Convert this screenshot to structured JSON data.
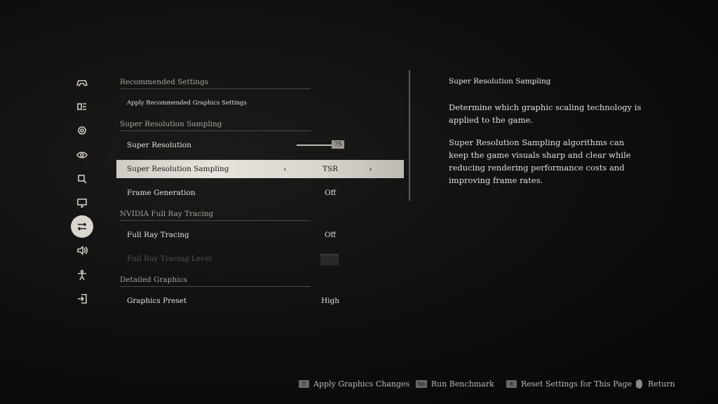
{
  "nav": [
    {
      "id": "gamepad",
      "icon": "gamepad-icon",
      "active": false
    },
    {
      "id": "display",
      "icon": "display-mode-icon",
      "active": false
    },
    {
      "id": "camera",
      "icon": "camera-icon",
      "active": false
    },
    {
      "id": "visibility",
      "icon": "eye-icon",
      "active": false
    },
    {
      "id": "search",
      "icon": "magnifier-icon",
      "active": false
    },
    {
      "id": "monitor",
      "icon": "monitor-icon",
      "active": false
    },
    {
      "id": "graphics",
      "icon": "sliders-icon",
      "active": true
    },
    {
      "id": "audio",
      "icon": "speaker-icon",
      "active": false
    },
    {
      "id": "accessibility",
      "icon": "accessibility-icon",
      "active": false
    },
    {
      "id": "exit",
      "icon": "exit-icon",
      "active": false
    }
  ],
  "settings": {
    "section_recommended": "Recommended Settings",
    "apply_recommended": "Apply Recommended Graphics Settings",
    "section_srs": "Super Resolution Sampling",
    "super_resolution": {
      "label": "Super Resolution",
      "value": "75",
      "level": 0.75
    },
    "srs": {
      "label": "Super Resolution Sampling",
      "value": "TSR"
    },
    "frame_generation": {
      "label": "Frame Generation",
      "value": "Off"
    },
    "section_rt": "NVIDIA Full Ray Tracing",
    "full_ray_tracing": {
      "label": "Full Ray Tracing",
      "value": "Off"
    },
    "rt_level": {
      "label": "Full Ray Tracing Level"
    },
    "section_detailed": "Detailed Graphics",
    "graphics_preset": {
      "label": "Graphics Preset",
      "value": "High"
    }
  },
  "description": {
    "title": "Super Resolution Sampling",
    "p1": "Determine which graphic scaling technology is applied to the game.",
    "p2": "Super Resolution Sampling algorithms can keep the game visuals sharp and clear while reducing rendering performance costs and improving frame rates."
  },
  "footer": {
    "apply": {
      "key": "T",
      "label": "Apply Graphics Changes"
    },
    "benchmark": {
      "key": "Tab",
      "label": "Run Benchmark"
    },
    "reset": {
      "key": "R",
      "label": "Reset Settings for This Page"
    },
    "return": {
      "label": "Return"
    }
  }
}
